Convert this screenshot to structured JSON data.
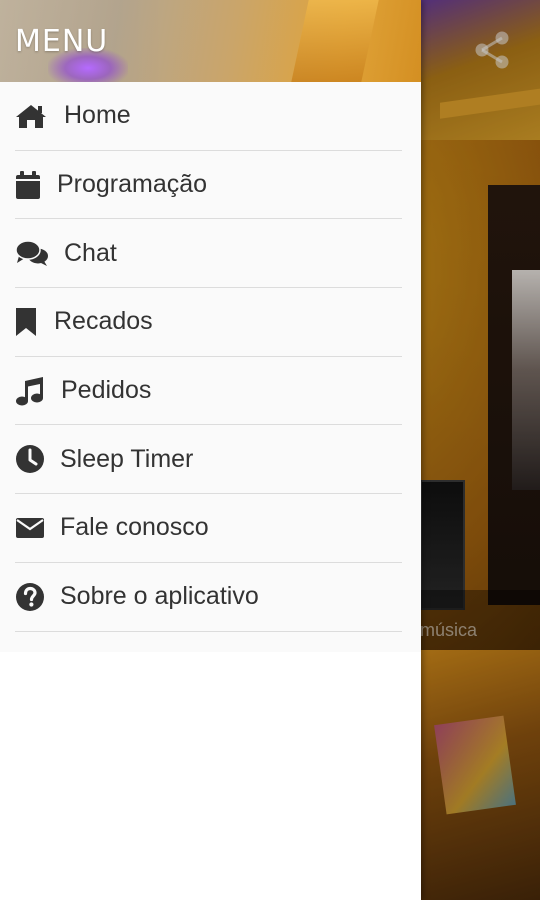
{
  "drawer": {
    "title": "MENU",
    "items": [
      {
        "label": "Home",
        "icon": "home-icon"
      },
      {
        "label": "Programação",
        "icon": "calendar-icon"
      },
      {
        "label": "Chat",
        "icon": "chat-icon"
      },
      {
        "label": "Recados",
        "icon": "bookmark-icon"
      },
      {
        "label": "Pedidos",
        "icon": "music-note-icon"
      },
      {
        "label": "Sleep Timer",
        "icon": "clock-icon"
      },
      {
        "label": "Fale conosco",
        "icon": "envelope-icon"
      },
      {
        "label": "Sobre o aplicativo",
        "icon": "question-circle-icon"
      }
    ]
  },
  "background": {
    "share_icon": "share-icon",
    "caption": "a música"
  },
  "colors": {
    "drawer_bg": "#fafafa",
    "text": "#333333",
    "icon": "#333333",
    "divider": "#dcdcdc",
    "accent_gold": "#d99a1a",
    "accent_purple": "#b56aff"
  }
}
